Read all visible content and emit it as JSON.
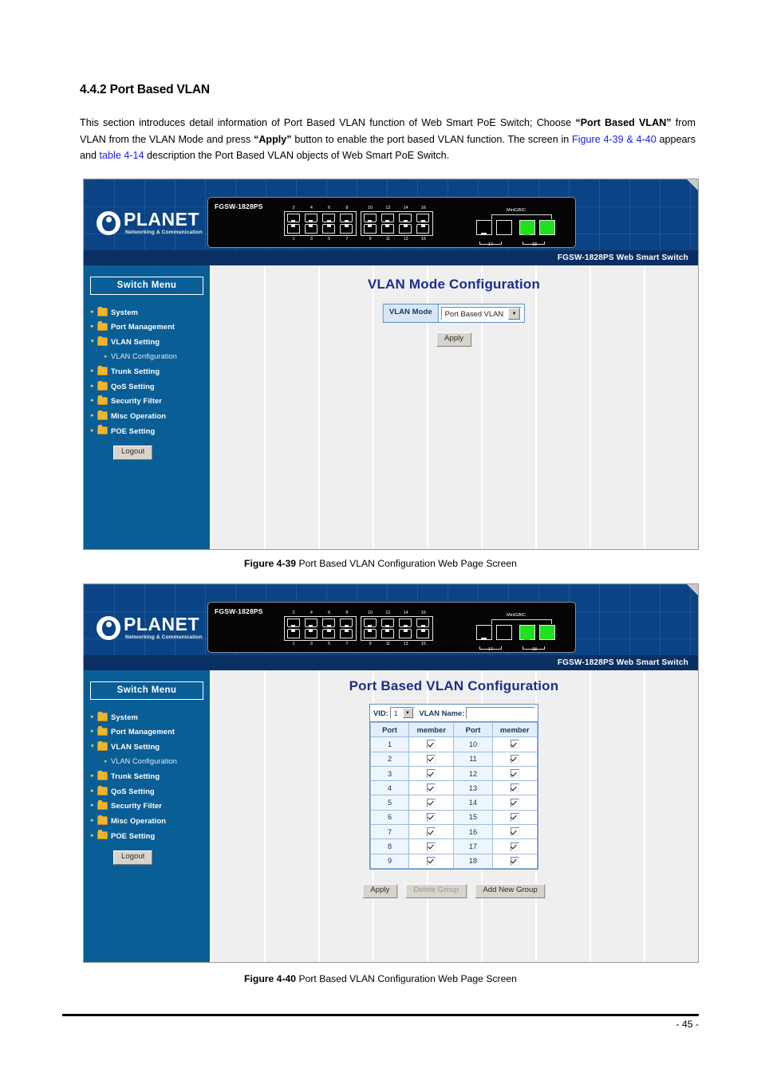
{
  "document": {
    "heading": "4.4.2 Port Based VLAN",
    "paragraph": {
      "t1": "This section introduces detail information of Port Based VLAN function of Web Smart PoE Switch; Choose ",
      "b1": "“Port Based VLAN”",
      "t2": " from VLAN from the VLAN Mode and press ",
      "b2": "“Apply”",
      "t3": " button to enable the port based VLAN function. The screen in ",
      "link1": "Figure 4-39 & 4-40",
      "t4": " appears and ",
      "link2": "table 4-14",
      "t5": " description the Port Based VLAN objects of Web Smart PoE Switch."
    },
    "caption_1_bold": "Figure 4-39",
    "caption_1_text": " Port Based VLAN Configuration Web Page Screen",
    "caption_2_bold": "Figure 4-40",
    "caption_2_text": " Port Based VLAN Configuration Web Page Screen",
    "page_number": "- 45 -"
  },
  "device": {
    "brand": "PLANET",
    "tagline": "Networking & Communication",
    "model_panel": "FGSW-1828PS",
    "banner_strip": "FGSW-1828PS Web Smart Switch",
    "minigbic_label": "MiniGBIC",
    "ports_top": [
      "2",
      "4",
      "6",
      "8",
      "10",
      "12",
      "14",
      "16"
    ],
    "ports_bottom": [
      "1",
      "3",
      "5",
      "7",
      "9",
      "11",
      "13",
      "15"
    ],
    "combo_ports": [
      "17",
      "18"
    ]
  },
  "sidebar": {
    "title": "Switch Menu",
    "items": [
      {
        "label": "System",
        "expanded": false,
        "sub": false
      },
      {
        "label": "Port Management",
        "expanded": false,
        "sub": false
      },
      {
        "label": "VLAN Setting",
        "expanded": true,
        "sub": false
      },
      {
        "label": "VLAN Configuration",
        "expanded": false,
        "sub": true
      },
      {
        "label": "Trunk Setting",
        "expanded": false,
        "sub": false
      },
      {
        "label": "QoS Setting",
        "expanded": false,
        "sub": false
      },
      {
        "label": "Security Filter",
        "expanded": false,
        "sub": false
      },
      {
        "label": "Misc Operation",
        "expanded": false,
        "sub": false
      },
      {
        "label": "POE Setting",
        "expanded": false,
        "sub": false
      }
    ],
    "logout_label": "Logout"
  },
  "screen_vlan_mode": {
    "title": "VLAN Mode Configuration",
    "mode_label": "VLAN Mode",
    "mode_value": "Port Based VLAN",
    "apply_label": "Apply"
  },
  "screen_port_based": {
    "title": "Port Based VLAN Configuration",
    "vid_label": "VID:",
    "vid_value": "1",
    "vlan_name_label": "VLAN Name:",
    "vlan_name_value": "",
    "columns": [
      "Port",
      "member",
      "Port",
      "member"
    ],
    "rows": [
      {
        "port_left": "1",
        "member_left": true,
        "port_right": "10",
        "member_right": true
      },
      {
        "port_left": "2",
        "member_left": true,
        "port_right": "11",
        "member_right": true
      },
      {
        "port_left": "3",
        "member_left": true,
        "port_right": "12",
        "member_right": true
      },
      {
        "port_left": "4",
        "member_left": true,
        "port_right": "13",
        "member_right": true
      },
      {
        "port_left": "5",
        "member_left": true,
        "port_right": "14",
        "member_right": true
      },
      {
        "port_left": "6",
        "member_left": true,
        "port_right": "15",
        "member_right": true
      },
      {
        "port_left": "7",
        "member_left": true,
        "port_right": "16",
        "member_right": true
      },
      {
        "port_left": "8",
        "member_left": true,
        "port_right": "17",
        "member_right": true
      },
      {
        "port_left": "9",
        "member_left": true,
        "port_right": "18",
        "member_right": true
      }
    ],
    "apply_label": "Apply",
    "delete_group_label": "Delete Group",
    "add_new_group_label": "Add New Group"
  },
  "colors": {
    "sidebar_blue": "#0a5e96",
    "banner_blue": "#0b4484",
    "strip_blue": "#0a2f63",
    "title_navy": "#1b2f8c",
    "table_border": "#5a8ec4",
    "link_blue": "#1a1aee",
    "led_green": "#20e020"
  }
}
